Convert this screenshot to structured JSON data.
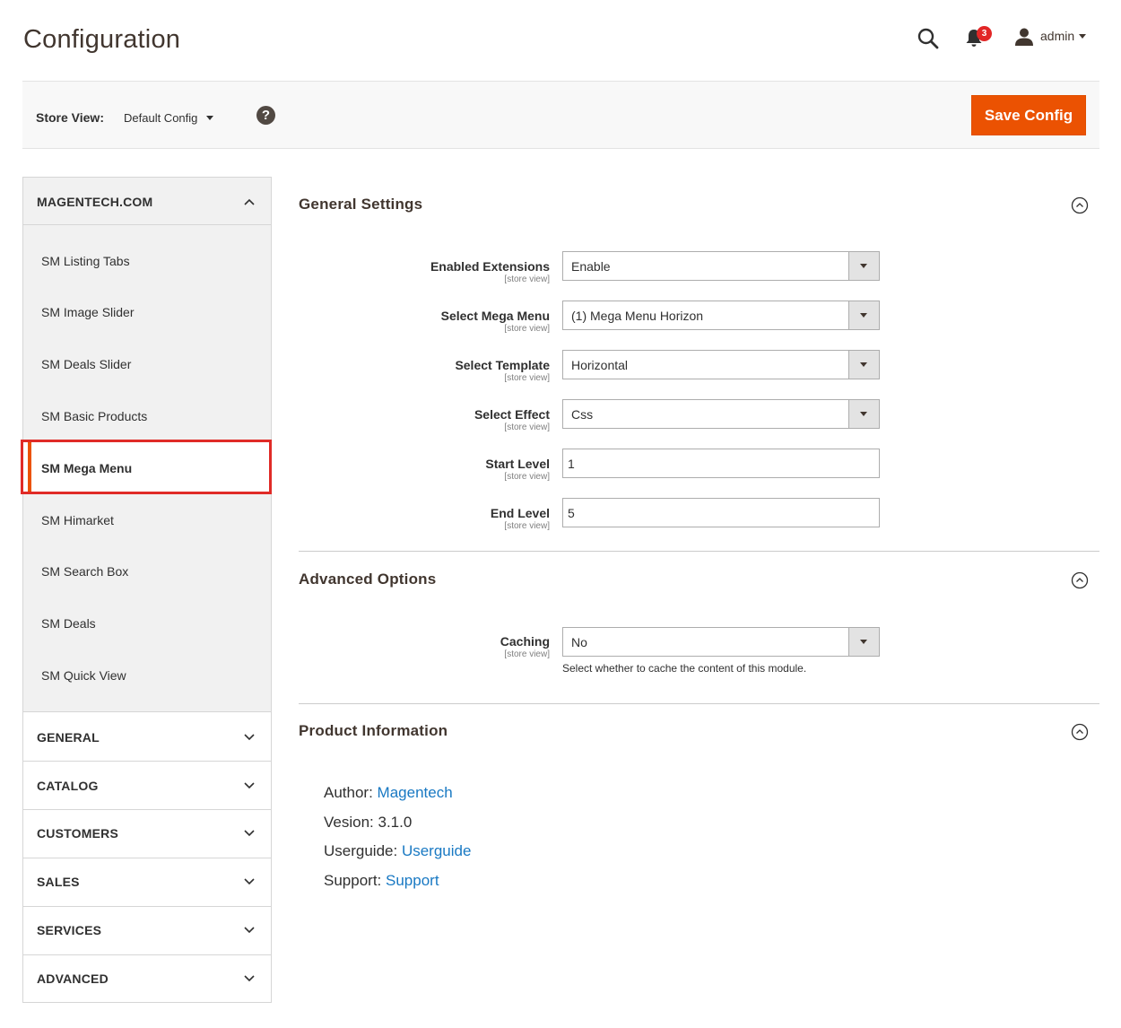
{
  "header": {
    "title": "Configuration",
    "notification_count": "3",
    "user_name": "admin"
  },
  "store_bar": {
    "label": "Store View:",
    "value": "Default Config",
    "save_label": "Save Config"
  },
  "sidebar": {
    "section_title": "MAGENTECH.COM",
    "items": [
      {
        "label": "SM Listing Tabs"
      },
      {
        "label": "SM Image Slider"
      },
      {
        "label": "SM Deals Slider"
      },
      {
        "label": "SM Basic Products"
      },
      {
        "label": "SM Mega Menu"
      },
      {
        "label": "SM Himarket"
      },
      {
        "label": "SM Search Box"
      },
      {
        "label": "SM Deals"
      },
      {
        "label": "SM Quick View"
      }
    ],
    "groups": [
      {
        "label": "GENERAL"
      },
      {
        "label": "CATALOG"
      },
      {
        "label": "CUSTOMERS"
      },
      {
        "label": "SALES"
      },
      {
        "label": "SERVICES"
      },
      {
        "label": "ADVANCED"
      }
    ]
  },
  "general_settings": {
    "title": "General Settings",
    "fields": [
      {
        "label": "Enabled Extensions",
        "scope": "[store view]",
        "value": "Enable"
      },
      {
        "label": "Select Mega Menu",
        "scope": "[store view]",
        "value": "(1) Mega Menu Horizon"
      },
      {
        "label": "Select Template",
        "scope": "[store view]",
        "value": "Horizontal"
      },
      {
        "label": "Select Effect",
        "scope": "[store view]",
        "value": "Css"
      },
      {
        "label": "Start Level",
        "scope": "[store view]",
        "value": "1"
      },
      {
        "label": "End Level",
        "scope": "[store view]",
        "value": "5"
      }
    ]
  },
  "advanced_options": {
    "title": "Advanced Options",
    "caching": {
      "label": "Caching",
      "scope": "[store view]",
      "value": "No",
      "note": "Select whether to cache the content of this module."
    }
  },
  "product_information": {
    "title": "Product Information",
    "author_label": "Author:",
    "author_value": "Magentech",
    "version_label": "Vesion:",
    "version_value": "3.1.0",
    "userguide_label": "Userguide:",
    "userguide_value": "Userguide",
    "support_label": "Support:",
    "support_value": "Support"
  },
  "colors": {
    "accent": "#eb5202",
    "highlight_box": "#e02b27",
    "link": "#1979c3",
    "badge": "#e22626"
  }
}
